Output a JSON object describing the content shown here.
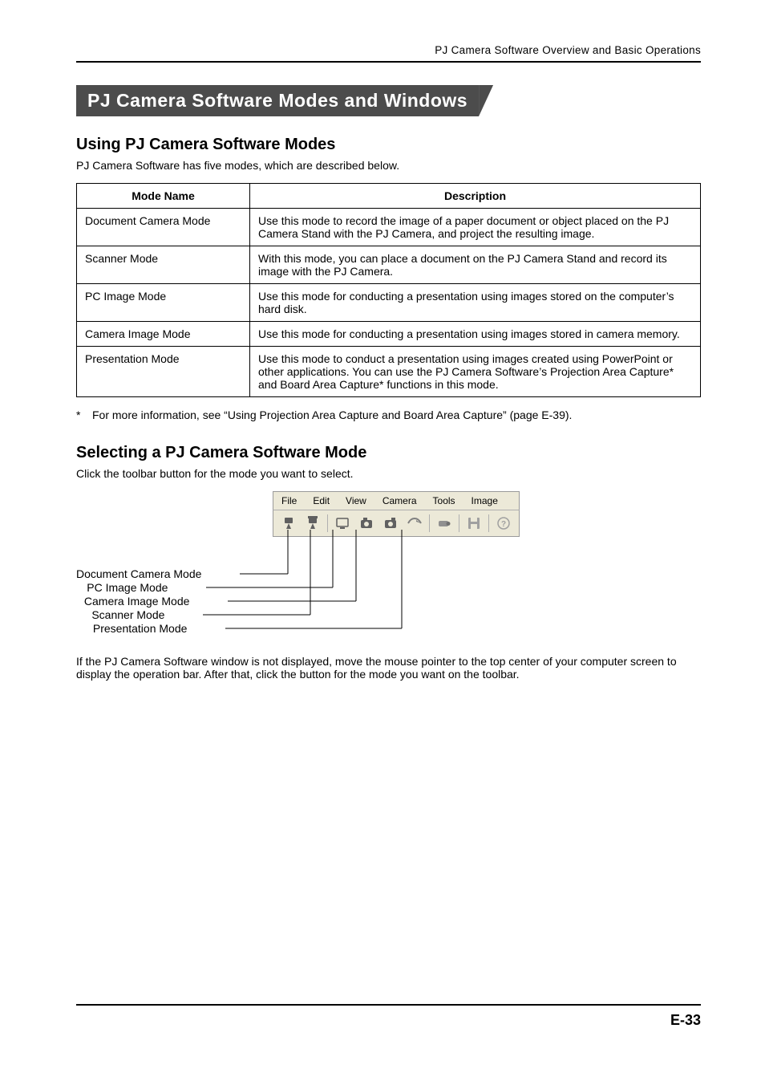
{
  "header_crumb": "PJ Camera Software Overview and Basic Operations",
  "title": "PJ Camera Software Modes and Windows",
  "section1": {
    "heading": "Using PJ Camera Software Modes",
    "intro": "PJ Camera Software has five modes, which are described below.",
    "th_mode": "Mode Name",
    "th_desc": "Description",
    "rows": [
      {
        "mode": "Document Camera Mode",
        "desc": "Use this mode to record the image of a paper document or object placed on the PJ Camera Stand with the PJ Camera, and project the resulting image."
      },
      {
        "mode": "Scanner Mode",
        "desc": "With this mode, you can place a document on the PJ Camera Stand and record its image with the PJ Camera."
      },
      {
        "mode": "PC Image Mode",
        "desc": "Use this mode for conducting a presentation using images stored on the computer’s hard disk."
      },
      {
        "mode": "Camera Image Mode",
        "desc": "Use this mode for conducting a presentation using images stored in camera memory."
      },
      {
        "mode": "Presentation Mode",
        "desc": "Use this mode to conduct a presentation using images created using PowerPoint or other applications. You can use the PJ Camera Software’s Projection Area Capture* and Board Area Capture* functions in this mode."
      }
    ]
  },
  "footnote": {
    "star": "*",
    "text": "For more information, see “Using Projection Area Capture and Board Area Capture” (page E-39)."
  },
  "section2": {
    "heading": "Selecting a PJ Camera Software Mode",
    "intro": "Click the toolbar button for the mode you want to select.",
    "after": "If the PJ Camera Software window is not displayed, move the mouse pointer to the top center of your computer screen to display the operation bar. After that, click the button for the mode you want on the toolbar."
  },
  "toolbar": {
    "menu": [
      "File",
      "Edit",
      "View",
      "Camera",
      "Tools",
      "Image"
    ],
    "labels": [
      "Document Camera Mode",
      "PC Image Mode",
      "Camera Image Mode",
      "Scanner Mode",
      "Presentation Mode"
    ]
  },
  "page_number": "E-33"
}
